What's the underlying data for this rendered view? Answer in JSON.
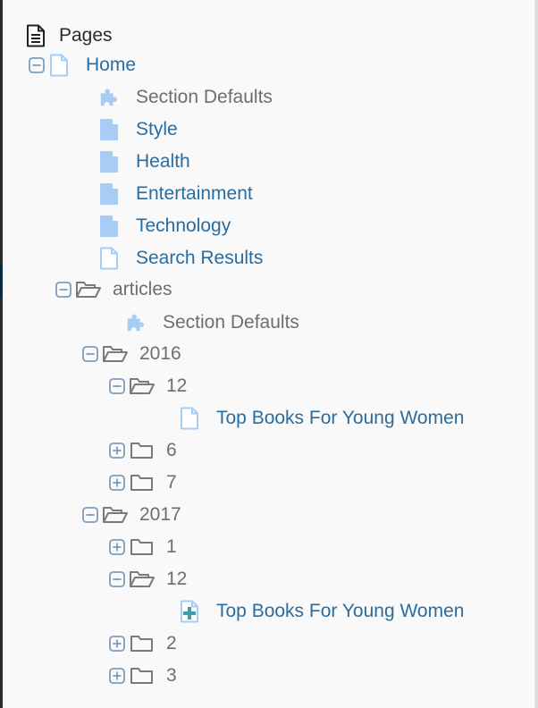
{
  "colors": {
    "link": "#2b6c9e",
    "muted_text": "#6e6e6e",
    "toggle": "#7f9cbd",
    "folder": "#7a7a7a",
    "page_fill": "#a7ccf5",
    "page_outline": "#a7ccf5",
    "add_plus": "#3aa0a8"
  },
  "tree": {
    "root_label": "Pages",
    "items": [
      {
        "label": "Home",
        "type": "page-outline",
        "toggle": "collapse",
        "style": "link"
      },
      {
        "label": "Section Defaults",
        "type": "puzzle",
        "toggle": null,
        "style": "muted"
      },
      {
        "label": "Style",
        "type": "page-filled",
        "toggle": null,
        "style": "link"
      },
      {
        "label": "Health",
        "type": "page-filled",
        "toggle": null,
        "style": "link"
      },
      {
        "label": "Entertainment",
        "type": "page-filled",
        "toggle": null,
        "style": "link"
      },
      {
        "label": "Technology",
        "type": "page-filled",
        "toggle": null,
        "style": "link"
      },
      {
        "label": "Search Results",
        "type": "page-outline",
        "toggle": null,
        "style": "link"
      },
      {
        "label": "articles",
        "type": "folder-open",
        "toggle": "collapse",
        "style": "muted"
      },
      {
        "label": "Section Defaults",
        "type": "puzzle",
        "toggle": null,
        "style": "muted"
      },
      {
        "label": "2016",
        "type": "folder-open",
        "toggle": "collapse",
        "style": "muted"
      },
      {
        "label": "12",
        "type": "folder-open",
        "toggle": "collapse",
        "style": "muted"
      },
      {
        "label": "Top Books For Young Women",
        "type": "page-outline",
        "toggle": null,
        "style": "link"
      },
      {
        "label": "6",
        "type": "folder-closed",
        "toggle": "expand",
        "style": "muted"
      },
      {
        "label": "7",
        "type": "folder-closed",
        "toggle": "expand",
        "style": "muted"
      },
      {
        "label": "2017",
        "type": "folder-open",
        "toggle": "collapse",
        "style": "muted"
      },
      {
        "label": "1",
        "type": "folder-closed",
        "toggle": "expand",
        "style": "muted"
      },
      {
        "label": "12",
        "type": "folder-open",
        "toggle": "collapse",
        "style": "muted"
      },
      {
        "label": "Top Books For Young Women",
        "type": "page-new",
        "toggle": null,
        "style": "link"
      },
      {
        "label": "2",
        "type": "folder-closed",
        "toggle": "expand",
        "style": "muted"
      },
      {
        "label": "3",
        "type": "folder-closed",
        "toggle": "expand",
        "style": "muted"
      }
    ]
  }
}
